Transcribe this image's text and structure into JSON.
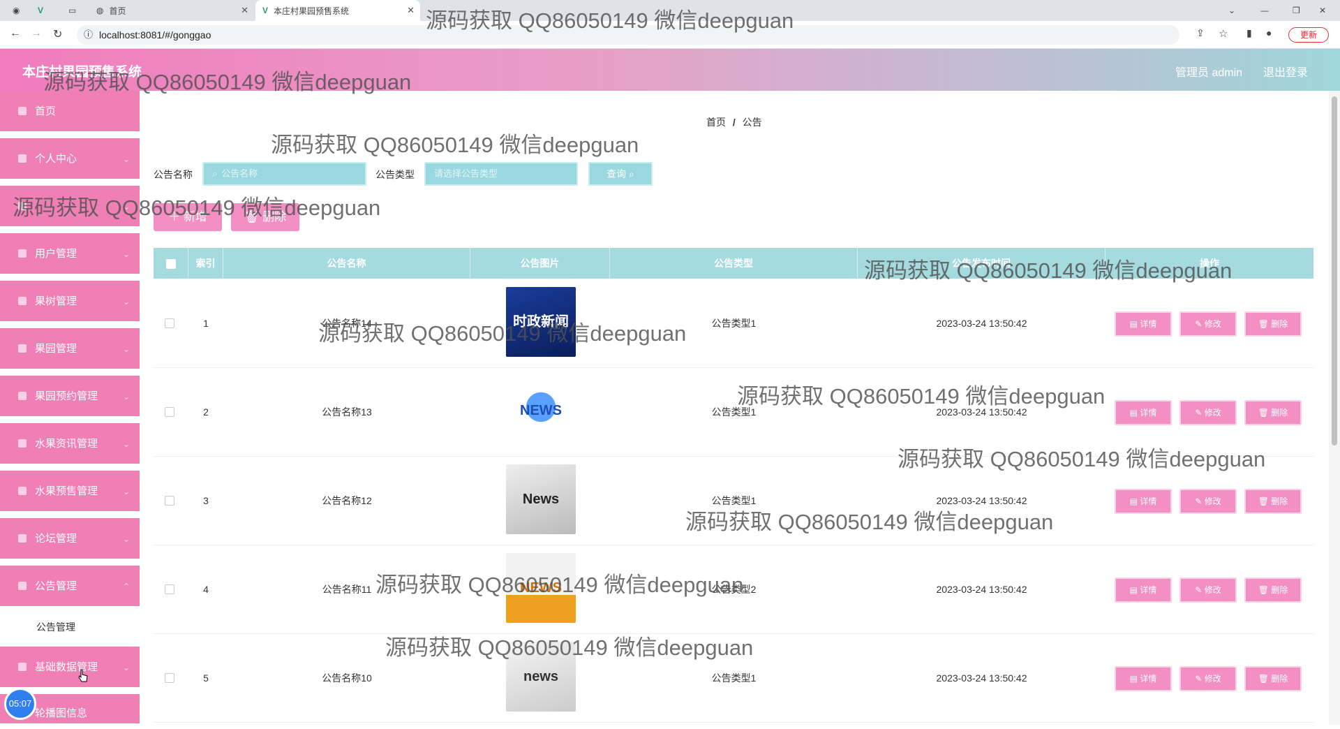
{
  "browser": {
    "tabs": [
      {
        "label": "首页"
      },
      {
        "label": "本庄村果园预售系统"
      }
    ],
    "url": "localhost:8081/#/gonggao",
    "update_label": "更新"
  },
  "header": {
    "brand": "本庄村果园预售系统",
    "admin": "管理员 admin",
    "logout": "退出登录"
  },
  "sidebar": {
    "items": [
      {
        "label": "首页"
      },
      {
        "label": "个人中心"
      },
      {
        "label": ""
      },
      {
        "label": "用户管理"
      },
      {
        "label": "果树管理"
      },
      {
        "label": "果园管理"
      },
      {
        "label": "果园预约管理"
      },
      {
        "label": "水果资讯管理"
      },
      {
        "label": "水果预售管理"
      },
      {
        "label": "论坛管理"
      },
      {
        "label": "公告管理"
      },
      {
        "label": "基础数据管理"
      },
      {
        "label": "轮播图信息"
      }
    ],
    "submenu_active": "公告管理"
  },
  "breadcrumb": {
    "home": "首页",
    "sep": "/",
    "current": "公告"
  },
  "search": {
    "name_label": "公告名称",
    "name_placeholder": "公告名称",
    "type_label": "公告类型",
    "type_placeholder": "请选择公告类型",
    "query_label": "查询 ⌕"
  },
  "toolbar": {
    "add_label": "＋ 新增",
    "delete_label": "🗑 删除"
  },
  "table": {
    "columns": [
      "索引",
      "公告名称",
      "公告图片",
      "公告类型",
      "公告发布时间",
      "操作"
    ],
    "rows": [
      {
        "index": "1",
        "name": "公告名称14",
        "type": "公告类型1",
        "time": "2023-03-24 13:50:42",
        "image": "时政新闻"
      },
      {
        "index": "2",
        "name": "公告名称13",
        "type": "公告类型1",
        "time": "2023-03-24 13:50:42",
        "image": "NEWS"
      },
      {
        "index": "3",
        "name": "公告名称12",
        "type": "公告类型1",
        "time": "2023-03-24 13:50:42",
        "image": "News"
      },
      {
        "index": "4",
        "name": "公告名称11",
        "type": "公告类型2",
        "time": "2023-03-24 13:50:42",
        "image": "NEWS"
      },
      {
        "index": "5",
        "name": "公告名称10",
        "type": "公告类型1",
        "time": "2023-03-24 13:50:42",
        "image": "news"
      }
    ],
    "actions": {
      "detail": "详情",
      "edit": "修改",
      "delete": "删除"
    }
  },
  "watermark": "源码获取 QQ86050149 微信deepguan",
  "timer": "05:07"
}
